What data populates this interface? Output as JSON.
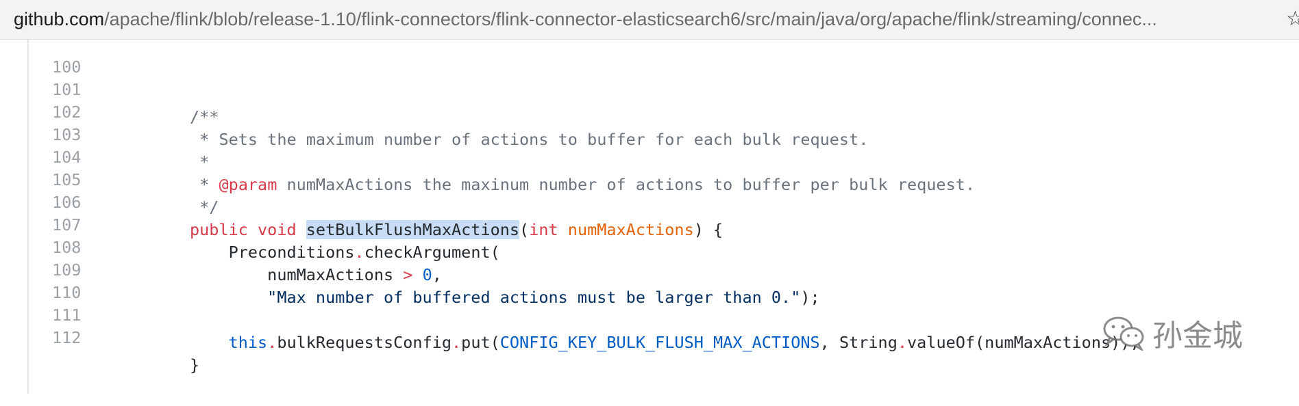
{
  "browser": {
    "url_domain": "github.com",
    "url_path": "/apache/flink/blob/release-1.10/flink-connectors/flink-connector-elasticsearch6/src/main/java/org/apache/flink/streaming/connec...",
    "star_icon": "star-icon"
  },
  "code": {
    "lines": [
      {
        "n": "100"
      },
      {
        "n": "101",
        "t": "/**"
      },
      {
        "n": "102",
        "t": " * Sets the maximum number of actions to buffer for each bulk request."
      },
      {
        "n": "103",
        "t": " *"
      },
      {
        "n": "104",
        "a": " * ",
        "b": "@param",
        "c": " numMaxActions the maxinum number of actions to buffer per bulk request."
      },
      {
        "n": "105",
        "t": " */"
      },
      {
        "n": "106",
        "kw": "public void ",
        "fn": "setBulkFlushMaxActions",
        "p1": "(",
        "ty": "int ",
        "pm": "numMaxActions",
        "p2": ") {"
      },
      {
        "n": "107",
        "a": "    Preconditions",
        "dot": ".",
        "b": "checkArgument("
      },
      {
        "n": "108",
        "a": "        numMaxActions ",
        "op": ">",
        "sp": " ",
        "num": "0",
        "b": ","
      },
      {
        "n": "109",
        "str": "        \"Max number of buffered actions must be larger than 0.\"",
        "b": ");"
      },
      {
        "n": "110"
      },
      {
        "n": "111",
        "kw": "    this",
        "d1": ".",
        "a": "bulkRequestsConfig",
        "d2": ".",
        "b": "put(",
        "const": "CONFIG_KEY_BULK_FLUSH_MAX_ACTIONS",
        "c": ", String",
        "d3": ".",
        "e": "valueOf(numMaxActions));"
      },
      {
        "n": "112",
        "t": "}"
      }
    ]
  },
  "watermark": {
    "text": "孙金城",
    "icon": "wechat-icon"
  }
}
